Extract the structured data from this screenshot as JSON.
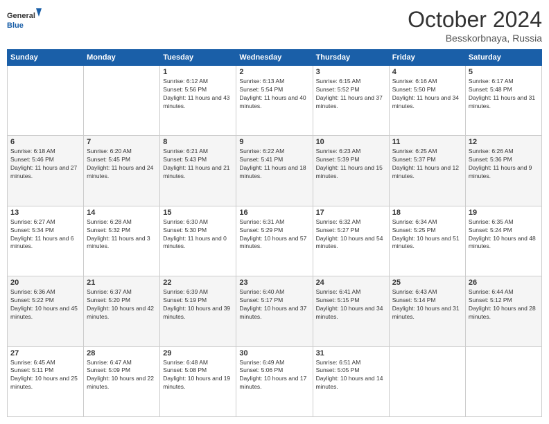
{
  "header": {
    "logo_line1": "General",
    "logo_line2": "Blue",
    "month": "October 2024",
    "location": "Besskorbnaya, Russia"
  },
  "weekdays": [
    "Sunday",
    "Monday",
    "Tuesday",
    "Wednesday",
    "Thursday",
    "Friday",
    "Saturday"
  ],
  "weeks": [
    [
      {
        "day": "",
        "sunrise": "",
        "sunset": "",
        "daylight": ""
      },
      {
        "day": "",
        "sunrise": "",
        "sunset": "",
        "daylight": ""
      },
      {
        "day": "1",
        "sunrise": "Sunrise: 6:12 AM",
        "sunset": "Sunset: 5:56 PM",
        "daylight": "Daylight: 11 hours and 43 minutes."
      },
      {
        "day": "2",
        "sunrise": "Sunrise: 6:13 AM",
        "sunset": "Sunset: 5:54 PM",
        "daylight": "Daylight: 11 hours and 40 minutes."
      },
      {
        "day": "3",
        "sunrise": "Sunrise: 6:15 AM",
        "sunset": "Sunset: 5:52 PM",
        "daylight": "Daylight: 11 hours and 37 minutes."
      },
      {
        "day": "4",
        "sunrise": "Sunrise: 6:16 AM",
        "sunset": "Sunset: 5:50 PM",
        "daylight": "Daylight: 11 hours and 34 minutes."
      },
      {
        "day": "5",
        "sunrise": "Sunrise: 6:17 AM",
        "sunset": "Sunset: 5:48 PM",
        "daylight": "Daylight: 11 hours and 31 minutes."
      }
    ],
    [
      {
        "day": "6",
        "sunrise": "Sunrise: 6:18 AM",
        "sunset": "Sunset: 5:46 PM",
        "daylight": "Daylight: 11 hours and 27 minutes."
      },
      {
        "day": "7",
        "sunrise": "Sunrise: 6:20 AM",
        "sunset": "Sunset: 5:45 PM",
        "daylight": "Daylight: 11 hours and 24 minutes."
      },
      {
        "day": "8",
        "sunrise": "Sunrise: 6:21 AM",
        "sunset": "Sunset: 5:43 PM",
        "daylight": "Daylight: 11 hours and 21 minutes."
      },
      {
        "day": "9",
        "sunrise": "Sunrise: 6:22 AM",
        "sunset": "Sunset: 5:41 PM",
        "daylight": "Daylight: 11 hours and 18 minutes."
      },
      {
        "day": "10",
        "sunrise": "Sunrise: 6:23 AM",
        "sunset": "Sunset: 5:39 PM",
        "daylight": "Daylight: 11 hours and 15 minutes."
      },
      {
        "day": "11",
        "sunrise": "Sunrise: 6:25 AM",
        "sunset": "Sunset: 5:37 PM",
        "daylight": "Daylight: 11 hours and 12 minutes."
      },
      {
        "day": "12",
        "sunrise": "Sunrise: 6:26 AM",
        "sunset": "Sunset: 5:36 PM",
        "daylight": "Daylight: 11 hours and 9 minutes."
      }
    ],
    [
      {
        "day": "13",
        "sunrise": "Sunrise: 6:27 AM",
        "sunset": "Sunset: 5:34 PM",
        "daylight": "Daylight: 11 hours and 6 minutes."
      },
      {
        "day": "14",
        "sunrise": "Sunrise: 6:28 AM",
        "sunset": "Sunset: 5:32 PM",
        "daylight": "Daylight: 11 hours and 3 minutes."
      },
      {
        "day": "15",
        "sunrise": "Sunrise: 6:30 AM",
        "sunset": "Sunset: 5:30 PM",
        "daylight": "Daylight: 11 hours and 0 minutes."
      },
      {
        "day": "16",
        "sunrise": "Sunrise: 6:31 AM",
        "sunset": "Sunset: 5:29 PM",
        "daylight": "Daylight: 10 hours and 57 minutes."
      },
      {
        "day": "17",
        "sunrise": "Sunrise: 6:32 AM",
        "sunset": "Sunset: 5:27 PM",
        "daylight": "Daylight: 10 hours and 54 minutes."
      },
      {
        "day": "18",
        "sunrise": "Sunrise: 6:34 AM",
        "sunset": "Sunset: 5:25 PM",
        "daylight": "Daylight: 10 hours and 51 minutes."
      },
      {
        "day": "19",
        "sunrise": "Sunrise: 6:35 AM",
        "sunset": "Sunset: 5:24 PM",
        "daylight": "Daylight: 10 hours and 48 minutes."
      }
    ],
    [
      {
        "day": "20",
        "sunrise": "Sunrise: 6:36 AM",
        "sunset": "Sunset: 5:22 PM",
        "daylight": "Daylight: 10 hours and 45 minutes."
      },
      {
        "day": "21",
        "sunrise": "Sunrise: 6:37 AM",
        "sunset": "Sunset: 5:20 PM",
        "daylight": "Daylight: 10 hours and 42 minutes."
      },
      {
        "day": "22",
        "sunrise": "Sunrise: 6:39 AM",
        "sunset": "Sunset: 5:19 PM",
        "daylight": "Daylight: 10 hours and 39 minutes."
      },
      {
        "day": "23",
        "sunrise": "Sunrise: 6:40 AM",
        "sunset": "Sunset: 5:17 PM",
        "daylight": "Daylight: 10 hours and 37 minutes."
      },
      {
        "day": "24",
        "sunrise": "Sunrise: 6:41 AM",
        "sunset": "Sunset: 5:15 PM",
        "daylight": "Daylight: 10 hours and 34 minutes."
      },
      {
        "day": "25",
        "sunrise": "Sunrise: 6:43 AM",
        "sunset": "Sunset: 5:14 PM",
        "daylight": "Daylight: 10 hours and 31 minutes."
      },
      {
        "day": "26",
        "sunrise": "Sunrise: 6:44 AM",
        "sunset": "Sunset: 5:12 PM",
        "daylight": "Daylight: 10 hours and 28 minutes."
      }
    ],
    [
      {
        "day": "27",
        "sunrise": "Sunrise: 6:45 AM",
        "sunset": "Sunset: 5:11 PM",
        "daylight": "Daylight: 10 hours and 25 minutes."
      },
      {
        "day": "28",
        "sunrise": "Sunrise: 6:47 AM",
        "sunset": "Sunset: 5:09 PM",
        "daylight": "Daylight: 10 hours and 22 minutes."
      },
      {
        "day": "29",
        "sunrise": "Sunrise: 6:48 AM",
        "sunset": "Sunset: 5:08 PM",
        "daylight": "Daylight: 10 hours and 19 minutes."
      },
      {
        "day": "30",
        "sunrise": "Sunrise: 6:49 AM",
        "sunset": "Sunset: 5:06 PM",
        "daylight": "Daylight: 10 hours and 17 minutes."
      },
      {
        "day": "31",
        "sunrise": "Sunrise: 6:51 AM",
        "sunset": "Sunset: 5:05 PM",
        "daylight": "Daylight: 10 hours and 14 minutes."
      },
      {
        "day": "",
        "sunrise": "",
        "sunset": "",
        "daylight": ""
      },
      {
        "day": "",
        "sunrise": "",
        "sunset": "",
        "daylight": ""
      }
    ]
  ]
}
